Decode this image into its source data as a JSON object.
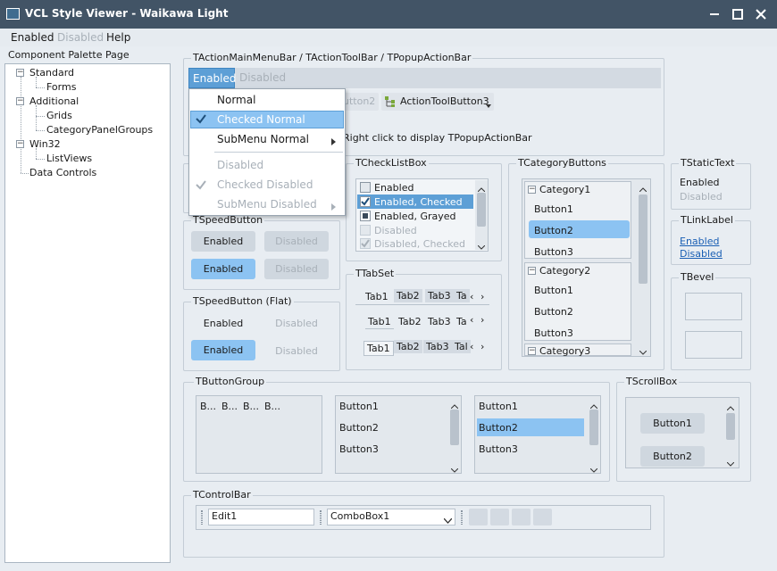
{
  "window": {
    "title": "VCL Style Viewer - Waikawa Light",
    "minimize_icon": "minimize-icon",
    "maximize_icon": "maximize-icon",
    "close_icon": "close-icon"
  },
  "menu": {
    "enabled": "Enabled",
    "disabled": "Disabled",
    "help": "Help"
  },
  "palette": {
    "header": "Component Palette Page",
    "items": {
      "standard": "Standard",
      "forms": "Forms",
      "additional": "Additional",
      "grids": "Grids",
      "category_panel_groups": "CategoryPanelGroups",
      "win32": "Win32",
      "listviews": "ListViews",
      "data_controls": "Data Controls"
    }
  },
  "action_bar": {
    "label": "TActionMainMenuBar / TActionToolBar / TPopupActionBar",
    "menu_enabled": "Enabled",
    "menu_disabled": "Disabled",
    "toolbutton2_partial": "utton2",
    "toolbutton3": "ActionToolButton3",
    "hint_partial": "Right click to display TPopupActionBar"
  },
  "popup": {
    "normal": "Normal",
    "checked_normal": "Checked Normal",
    "submenu_normal": "SubMenu Normal",
    "disabled": "Disabled",
    "checked_disabled": "Checked Disabled",
    "submenu_disabled": "SubMenu Disabled"
  },
  "speed_button": {
    "label": "TSpeedButton",
    "enabled1": "Enabled",
    "disabled1": "Disabled",
    "enabled2": "Enabled",
    "disabled2": "Disabled"
  },
  "speed_button_flat": {
    "label": "TSpeedButton (Flat)",
    "enabled1": "Enabled",
    "disabled1": "Disabled",
    "enabled2": "Enabled",
    "disabled2": "Disabled"
  },
  "checklist": {
    "label": "TCheckListBox",
    "items": [
      "Enabled",
      "Enabled, Checked",
      "Enabled, Grayed",
      "Disabled",
      "Disabled, Checked"
    ]
  },
  "tabset": {
    "label": "TTabSet",
    "row1": [
      "Tab1",
      "Tab2",
      "Tab3",
      "Ta"
    ],
    "row2": [
      "Tab1",
      "Tab2",
      "Tab3",
      "Ta"
    ],
    "row3": [
      "Tab1",
      "Tab2",
      "Tab3",
      "Tal"
    ]
  },
  "category_buttons": {
    "label": "TCategoryButtons",
    "cat1": "Category1",
    "cat2": "Category2",
    "cat3": "Category3",
    "b1": "Button1",
    "b2": "Button2",
    "b3": "Button3"
  },
  "static_text": {
    "label": "TStaticText",
    "enabled": "Enabled",
    "disabled": "Disabled"
  },
  "link_label": {
    "label": "TLinkLabel",
    "enabled": "Enabled",
    "disabled": "Disabled"
  },
  "bevel": {
    "label": "TBevel"
  },
  "button_group": {
    "label": "TButtonGroup",
    "compact": [
      "B...",
      "B...",
      "B...",
      "B..."
    ],
    "list1": [
      "Button1",
      "Button2",
      "Button3"
    ],
    "list2": [
      "Button1",
      "Button2",
      "Button3"
    ]
  },
  "scrollbox": {
    "label": "TScrollBox",
    "b1": "Button1",
    "b2": "Button2"
  },
  "controlbar": {
    "label": "TControlBar",
    "edit": "Edit1",
    "combo": "ComboBox1"
  },
  "colors": {
    "titlebar": "#425466",
    "selection": "#8cc3f2",
    "accent": "#5d9fd6"
  }
}
